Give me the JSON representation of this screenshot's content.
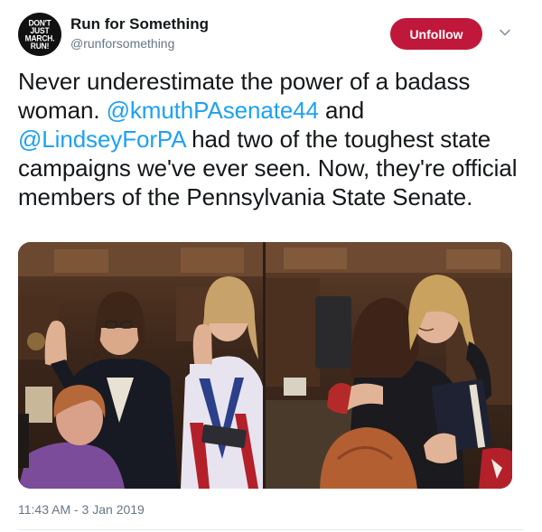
{
  "account": {
    "avatar_text": "DON'T\nJUST\nMARCH.\nRUN!",
    "name": "Run for Something",
    "handle": "@runforsomething"
  },
  "actions": {
    "unfollow_label": "Unfollow",
    "menu_icon": "chevron-down-icon"
  },
  "tweet": {
    "text_1": "Never underestimate the power of a badass woman. ",
    "mention_1": "@kmuthPAsenate44",
    "text_2": " and ",
    "mention_2": "@LindseyForPA",
    "text_3": " had two of the toughest state campaigns we've ever seen. Now, they're official members of the Pennsylvania State Senate."
  },
  "timestamp": "11:43 AM - 3 Jan 2019",
  "colors": {
    "unfollow_bg": "#c0183a",
    "mention": "#1da1f2",
    "secondary_text": "#657786"
  }
}
